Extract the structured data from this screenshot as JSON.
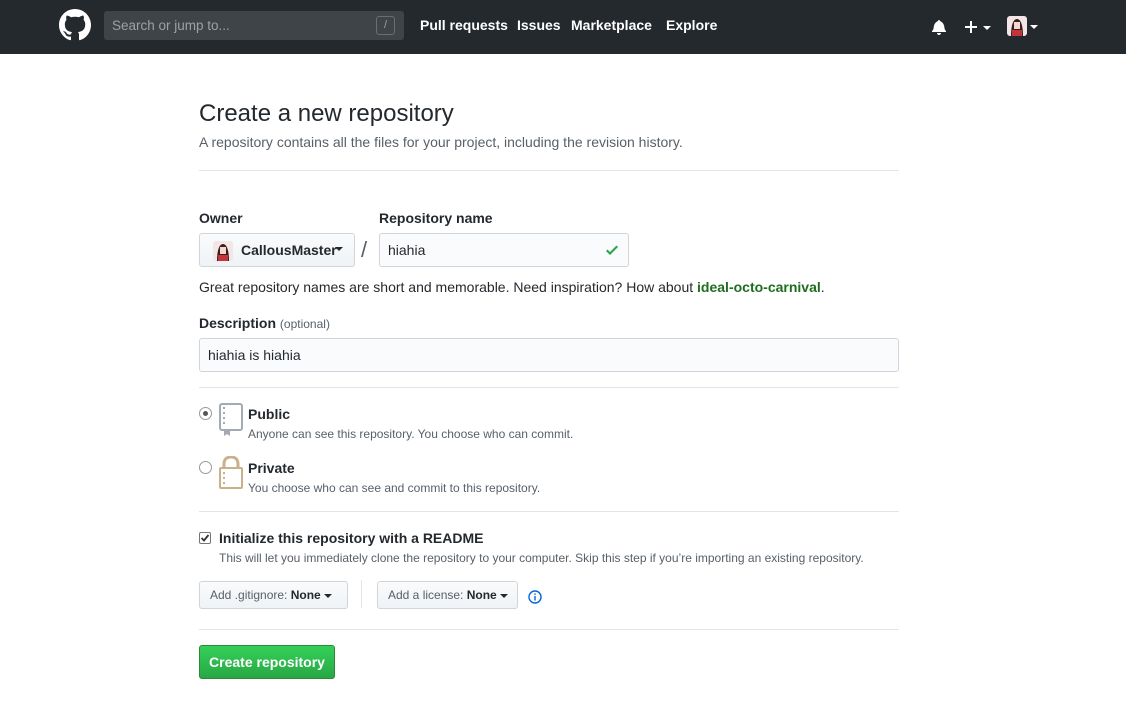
{
  "header": {
    "search_placeholder": "Search or jump to...",
    "search_shortcut": "/",
    "nav": [
      "Pull requests",
      "Issues",
      "Marketplace",
      "Explore"
    ]
  },
  "page": {
    "title": "Create a new repository",
    "subtitle": "A repository contains all the files for your project, including the revision history."
  },
  "form": {
    "owner_label": "Owner",
    "owner_value": "CallousMaster",
    "separator": "/",
    "repo_name_label": "Repository name",
    "repo_name_value": "hiahia",
    "hint_prefix": "Great repository names are short and memorable. Need inspiration? How about ",
    "hint_suggestion": "ideal-octo-carnival",
    "hint_suffix": ".",
    "description_label": "Description",
    "description_optional": "(optional)",
    "description_value": "hiahia is hiahia",
    "visibility": [
      {
        "label": "Public",
        "note": "Anyone can see this repository. You choose who can commit.",
        "selected": true,
        "icon": "repo-icon"
      },
      {
        "label": "Private",
        "note": "You choose who can see and commit to this repository.",
        "selected": false,
        "icon": "lock-icon"
      }
    ],
    "readme_label": "Initialize this repository with a README",
    "readme_note": "This will let you immediately clone the repository to your computer. Skip this step if you’re importing an existing repository.",
    "readme_checked": true,
    "gitignore_prefix": "Add .gitignore:",
    "gitignore_value": "None",
    "license_prefix": "Add a license:",
    "license_value": "None",
    "submit_label": "Create repository"
  },
  "colors": {
    "header_bg": "#24292e",
    "primary_button": "#28a745",
    "suggestion": "#1e6e1e",
    "info_icon": "#0366d6"
  }
}
